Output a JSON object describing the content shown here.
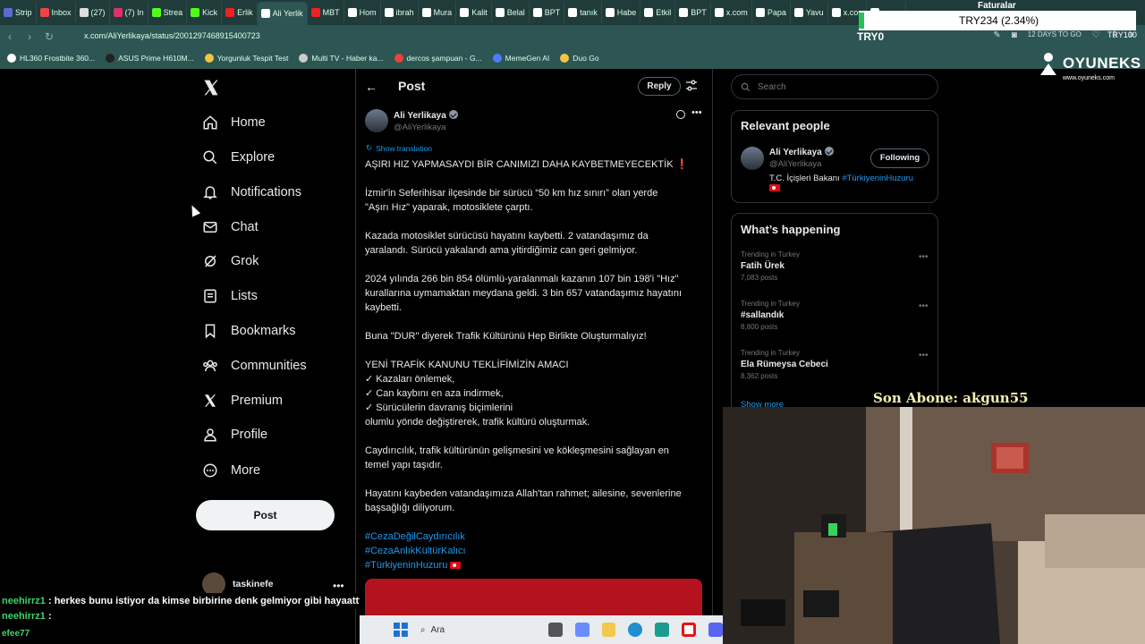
{
  "browser": {
    "tabs": [
      {
        "label": "Strip",
        "color": "#5b6bd6"
      },
      {
        "label": "Inbox",
        "color": "#e44"
      },
      {
        "label": "(27)",
        "color": "#ddd"
      },
      {
        "label": "(7) In",
        "color": "#e1306c"
      },
      {
        "label": "Strea",
        "color": "#53fc18"
      },
      {
        "label": "Kick",
        "color": "#53fc18"
      },
      {
        "label": "Erlik",
        "color": "#e22"
      },
      {
        "label": "Ali Yerlik",
        "color": "#fff",
        "active": true
      },
      {
        "label": "MBT",
        "color": "#e22"
      },
      {
        "label": "Hom",
        "color": "#fff"
      },
      {
        "label": "ibrah",
        "color": "#fff"
      },
      {
        "label": "Mura",
        "color": "#fff"
      },
      {
        "label": "Kalit",
        "color": "#fff"
      },
      {
        "label": "Belal",
        "color": "#fff"
      },
      {
        "label": "BPT",
        "color": "#fff"
      },
      {
        "label": "tanık",
        "color": "#fff"
      },
      {
        "label": "Habe",
        "color": "#fff"
      },
      {
        "label": "Etkil",
        "color": "#fff"
      },
      {
        "label": "BPT",
        "color": "#fff"
      },
      {
        "label": "x.com",
        "color": "#fff"
      },
      {
        "label": "Papa",
        "color": "#fff"
      },
      {
        "label": "Yavu",
        "color": "#fff"
      },
      {
        "label": "x.con",
        "color": "#fff"
      },
      {
        "label": "x.con",
        "color": "#fff"
      }
    ],
    "url": "x.com/AliYerlikaya/status/2001297468915400723",
    "bookmarks": [
      {
        "label": "HL360 Frostbite 360...",
        "color": "#fff"
      },
      {
        "label": "ASUS Prime H610M...",
        "color": "#222"
      },
      {
        "label": "Yorgunluk Tespit Test",
        "color": "#f4c542"
      },
      {
        "label": "Multi TV - Haber ka...",
        "color": "#ccc"
      },
      {
        "label": "dercos şampuan - G...",
        "color": "#ea4335"
      },
      {
        "label": "MemeGen AI",
        "color": "#4d7cfe"
      },
      {
        "label": "Duo Go",
        "color": "#f4c542"
      }
    ],
    "date_label": "12 DAYS TO GO"
  },
  "overlay": {
    "faturalar": "Faturalar",
    "ticker": "TRY234 (2.34%)",
    "try_left": "TRY0",
    "try_right": "TRY100",
    "son_abone": "Son Abone: akgun55",
    "logo_text": "OYUNEKS",
    "logo_sub": "www.oyuneks.com"
  },
  "chat": {
    "line1_user": "neehirrz1",
    "line1_text": " : herkes bunu istiyor da kimse birbirine denk gelmiyor gibi hayaattt",
    "line2_user": "neehirrz1",
    "line2_text": " :",
    "line3_user": "efee77"
  },
  "taskbar": {
    "search_placeholder": "Ara"
  },
  "nav": {
    "items": [
      "Home",
      "Explore",
      "Notifications",
      "Chat",
      "Grok",
      "Lists",
      "Bookmarks",
      "Communities",
      "Premium",
      "Profile",
      "More"
    ],
    "post_button": "Post",
    "account_name": "taskinefe"
  },
  "post": {
    "header_title": "Post",
    "reply_button": "Reply",
    "author_name": "Ali Yerlikaya",
    "author_handle": "@AliYerlikaya",
    "show_translation": "Show translation",
    "headline": "AŞIRI HIZ YAPMASAYDI BİR CANIMIZI DAHA KAYBETMEYECEKTİK",
    "paragraphs": [
      [
        "İzmir'in Seferihisar ilçesinde bir sürücü “50 km hız sınırı” olan yerde",
        "\"Aşırı Hız\" yaparak, motosiklete çarptı."
      ],
      [
        "Kazada motosiklet sürücüsü hayatını kaybetti. 2 vatandaşımız da",
        "yaralandı. Sürücü yakalandı ama yitirdiğimiz can geri gelmiyor."
      ],
      [
        "2024 yılında 266 bin 854 ölümlü-yaralanmalı kazanın 107 bin 198'i \"Hız\"",
        "kurallarına uymamaktan meydana geldi. 3 bin 657 vatandaşımız hayatını",
        "kaybetti."
      ],
      [
        "Buna \"DUR\" diyerek Trafik Kültürünü Hep Birlikte Oluşturmalıyız!"
      ],
      [
        "YENİ TRAFİK KANUNU TEKLİFİMİZİN AMACI",
        "✓ Kazaları önlemek,",
        "✓ Can kaybını en aza indirmek,",
        "✓ Sürücülerin davranış biçimlerini",
        "olumlu yönde değiştirerek, trafik kültürü oluşturmak."
      ],
      [
        "Caydırıcılık, trafik kültürünün gelişmesini ve kökleşmesini sağlayan en",
        "temel yapı taşıdır."
      ],
      [
        "Hayatını kaybeden vatandaşımıza Allah'tan rahmet; ailesine, sevenlerine",
        "başsağlığı diliyorum."
      ]
    ],
    "hashtags": [
      "#CezaDeğilCaydırıcılık",
      "#CezaAnlıkKültürKalıcı",
      "#TürkiyeninHuzuru"
    ]
  },
  "sidebar": {
    "search_placeholder": "Search",
    "relevant_title": "Relevant people",
    "person_name": "Ali Yerlikaya",
    "person_handle": "@AliYerlikaya",
    "follow_button": "Following",
    "bio_text": "T.C. İçişleri Bakanı ",
    "bio_tag": "#TürkiyeninHuzuru",
    "happening_title": "What’s happening",
    "trends": [
      {
        "category": "Trending in Turkey",
        "name": "Fatih Ürek",
        "count": "7,083 posts"
      },
      {
        "category": "Trending in Turkey",
        "name": "#sallandık",
        "count": "8,800 posts"
      },
      {
        "category": "Trending in Turkey",
        "name": "Ela Rümeysa Cebeci",
        "count": "8,362 posts"
      }
    ],
    "show_more": "Show more"
  },
  "colors": {
    "accent": "#1d9bf0",
    "brand_bg": "#2d5553",
    "post_red": "#b4121f"
  }
}
